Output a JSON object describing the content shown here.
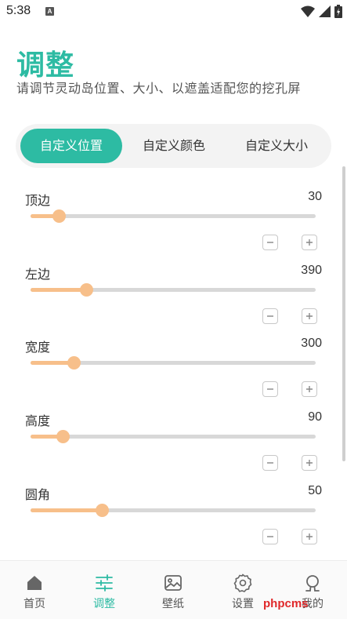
{
  "status_bar": {
    "time": "5:38",
    "notification_letter": "A"
  },
  "header": {
    "title": "调整",
    "subtitle": "请调节灵动岛位置、大小、以遮盖适配您的挖孔屏"
  },
  "tabs": [
    {
      "label": "自定义位置",
      "active": true
    },
    {
      "label": "自定义颜色",
      "active": false
    },
    {
      "label": "自定义大小",
      "active": false
    }
  ],
  "sliders": [
    {
      "label": "顶边",
      "value": "30",
      "fill_fraction": 0.1
    },
    {
      "label": "左边",
      "value": "390",
      "fill_fraction": 0.195
    },
    {
      "label": "宽度",
      "value": "300",
      "fill_fraction": 0.152
    },
    {
      "label": "高度",
      "value": "90",
      "fill_fraction": 0.113
    },
    {
      "label": "圆角",
      "value": "50",
      "fill_fraction": 0.25
    }
  ],
  "bottom_nav": [
    {
      "label": "首页",
      "icon": "home-icon",
      "active": false
    },
    {
      "label": "调整",
      "icon": "sliders-icon",
      "active": true
    },
    {
      "label": "壁纸",
      "icon": "image-icon",
      "active": false
    },
    {
      "label": "设置",
      "icon": "gear-icon",
      "active": false
    },
    {
      "label": "我的",
      "icon": "user-icon",
      "active": false
    }
  ],
  "watermark": "phpcms",
  "colors": {
    "accent": "#2dbba3",
    "slider_fill": "#f7bf8a",
    "track": "#d8d8d8"
  }
}
